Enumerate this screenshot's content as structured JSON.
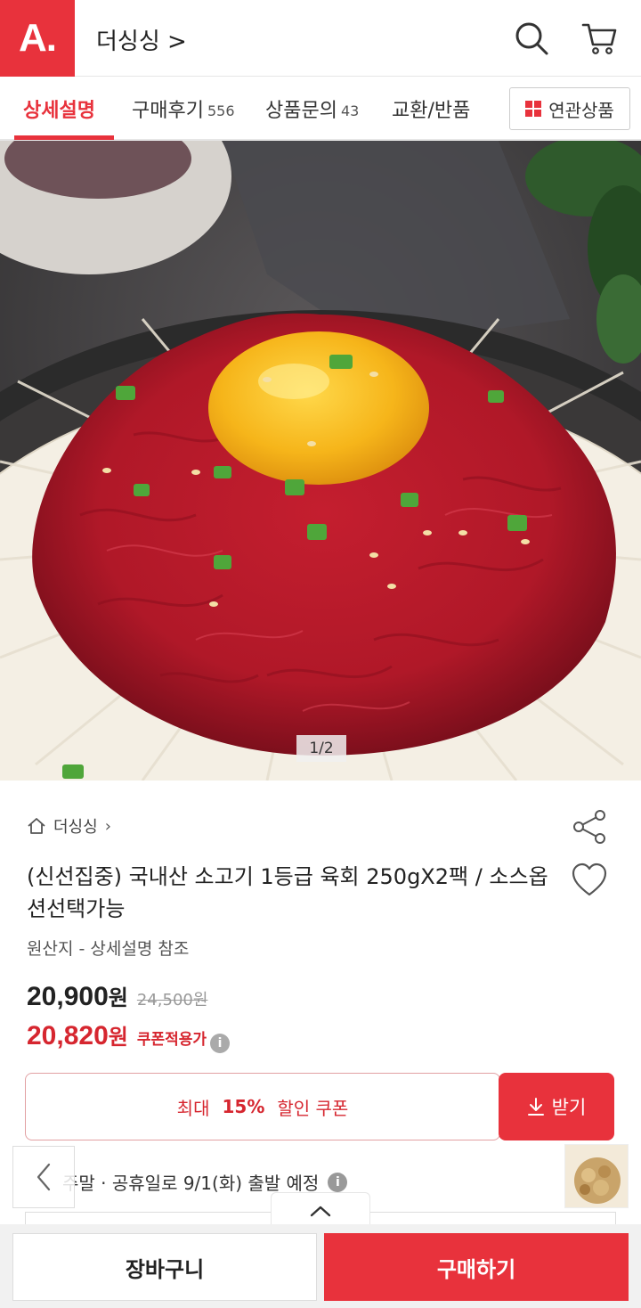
{
  "header": {
    "logo": "A.",
    "store_name": "더싱싱 >"
  },
  "tabs": [
    {
      "label": "상세설명",
      "count": ""
    },
    {
      "label": "구매후기",
      "count": "556"
    },
    {
      "label": "상품문의",
      "count": "43"
    },
    {
      "label": "교환/반품",
      "count": ""
    }
  ],
  "related_label": "연관상품",
  "gallery": {
    "pager": "1/2"
  },
  "product": {
    "brand": "더싱싱",
    "title": "(신선집중) 국내산 소고기 1등급 육회 250gX2팩 / 소스옵션선택가능",
    "origin": "원산지 - 상세설명 참조",
    "price": "20,900",
    "price_unit": "원",
    "original_price": "24,500원",
    "coupon_price": "20,820",
    "coupon_price_unit": "원",
    "coupon_label": "쿠폰적용가"
  },
  "coupon": {
    "prefix": "최대",
    "percent": "15%",
    "suffix": "할인 쿠폰",
    "receive_label": "받기"
  },
  "shipping": {
    "text": "주말 · 공휴일로 9/1(화) 출발 예정"
  },
  "bottom": {
    "cart_label": "장바구니",
    "buy_label": "구매하기"
  },
  "colors": {
    "accent": "#e8323c"
  }
}
